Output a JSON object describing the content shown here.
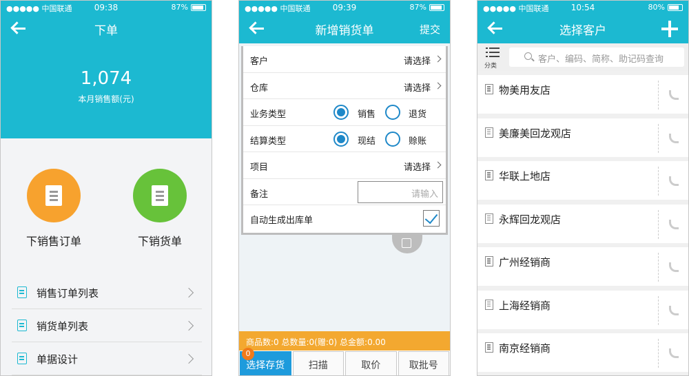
{
  "status1": {
    "carrier": "●●●●● 中国联通",
    "time": "09:38",
    "battery": "87%"
  },
  "status2": {
    "carrier": "●●●●● 中国联通",
    "time": "09:39",
    "battery": "87%"
  },
  "status3": {
    "carrier": "●●●●● 中国联通",
    "time": "10:54",
    "battery": "80%"
  },
  "battery_levels": [
    0.87,
    0.87,
    0.8
  ],
  "colors": {
    "primary": "#1cb9d1",
    "orange": "#f7a22e",
    "green": "#67c23a",
    "summary": "#f3a830",
    "accent": "#1e88c8"
  },
  "screen1": {
    "title": "下单",
    "hero_value": "1,074",
    "hero_label": "本月销售额(元)",
    "big_buttons": [
      {
        "label": "下销售订单",
        "icon": "clipboard-icon"
      },
      {
        "label": "下销货单",
        "icon": "receipt-icon"
      }
    ],
    "menu": [
      {
        "label": "销售订单列表",
        "icon": "order-list-icon"
      },
      {
        "label": "销货单列表",
        "icon": "sales-list-icon"
      },
      {
        "label": "单据设计",
        "icon": "design-icon"
      }
    ]
  },
  "screen2": {
    "title": "新增销货单",
    "submit": "提交",
    "customer": {
      "label": "客户",
      "value": "请选择"
    },
    "warehouse": {
      "label": "仓库",
      "value": "请选择"
    },
    "biz_type": {
      "label": "业务类型",
      "opt1": "销售",
      "opt2": "退货",
      "selected": "销售"
    },
    "settle_type": {
      "label": "结算类型",
      "opt1": "现结",
      "opt2": "赊账",
      "selected": "现结"
    },
    "project": {
      "label": "项目",
      "value": "请选择"
    },
    "remark": {
      "label": "备注",
      "placeholder": "请输入"
    },
    "auto_outbound": {
      "label": "自动生成出库单",
      "checked": true
    },
    "summary": "商品数:0  总数量:0(赠:0)  总金额:0.00",
    "tabs": {
      "select": "选择存货",
      "badge": "0",
      "scan": "扫描",
      "price": "取价",
      "batch": "取批号"
    }
  },
  "screen3": {
    "title": "选择客户",
    "category": "分类",
    "search_placeholder": "客户、编码、简称、助记码查询",
    "customers": [
      "物美用友店",
      "美廉美回龙观店",
      "华联上地店",
      "永辉回龙观店",
      "广州经销商",
      "上海经销商",
      "南京经销商"
    ]
  }
}
